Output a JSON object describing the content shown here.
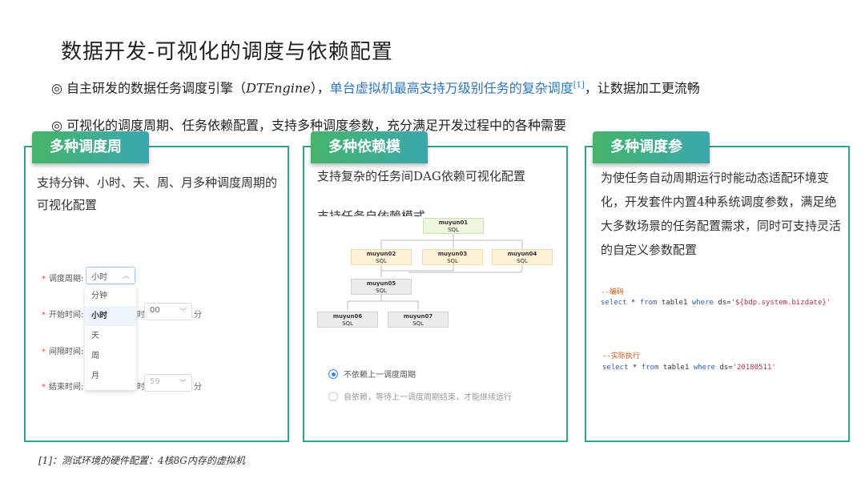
{
  "title": "数据开发-可视化的调度与依赖配置",
  "bullets": {
    "b1_prefix": "◎ 自主研发的数据任务调度引擎（",
    "b1_engine": "DTEngine",
    "b1_mid": "），",
    "b1_highlight": "单台虚拟机最高支持万级别任务的复杂调度",
    "b1_ref": "[1]",
    "b1_suffix": "，让数据加工更流畅",
    "b2": "◎ 可视化的调度周期、任务依赖配置，支持多种调度参数，充分满足开发过程中的各种需要"
  },
  "card1": {
    "tag": "多种调度周期",
    "desc": "支持分钟、小时、天、周、月多种调度周期的可视化配置",
    "form": {
      "period_label": "调度周期:",
      "period_value": "小时",
      "start_label": "开始时间:",
      "interval_label": "间隔时间:",
      "end_label": "结束时间:",
      "options": [
        "分钟",
        "小时",
        "天",
        "周",
        "月"
      ],
      "hour_unit": "时",
      "minute_unit": "分",
      "start_minute": "00",
      "end_minute": "59"
    }
  },
  "card2": {
    "tag": "多种依赖模式",
    "desc": "支持复杂的任务间DAG依赖可视化配置",
    "desc2": "支持任务自依赖模式",
    "nodes": [
      {
        "name": "muyun01",
        "type": "SQL"
      },
      {
        "name": "muyun02",
        "type": "SQL"
      },
      {
        "name": "muyun03",
        "type": "SQL"
      },
      {
        "name": "muyun04",
        "type": "SQL"
      },
      {
        "name": "muyun05",
        "type": "SQL"
      },
      {
        "name": "muyun06",
        "type": "SQL"
      },
      {
        "name": "muyun07",
        "type": "SQL"
      }
    ],
    "radio1": "不依赖上一调度周期",
    "radio2": "自依赖，等待上一调度周期结束，才能继续运行"
  },
  "card3": {
    "tag": "多种调度参数",
    "desc": "为使任务自动周期运行时能动态适配环境变化，开发套件内置4种系统调度参数，满足绝大多数场景的任务配置需求，同时可支持灵活的自定义参数配置",
    "code1_comment": "--编码",
    "code1_kw1": "select",
    "code1_mid1": " * ",
    "code1_kw2": "from",
    "code1_mid2": " table1 ",
    "code1_kw3": "where",
    "code1_mid3": " ds=",
    "code1_str": "'${bdp.system.bizdate}'",
    "code2_comment": "--实际执行",
    "code2_str": "'20180511'"
  },
  "footnote": "[1]：测试环境的硬件配置：4核8G内存的虚拟机",
  "colors": {
    "border": "#2ea38f",
    "accent": "#2e75b6"
  }
}
